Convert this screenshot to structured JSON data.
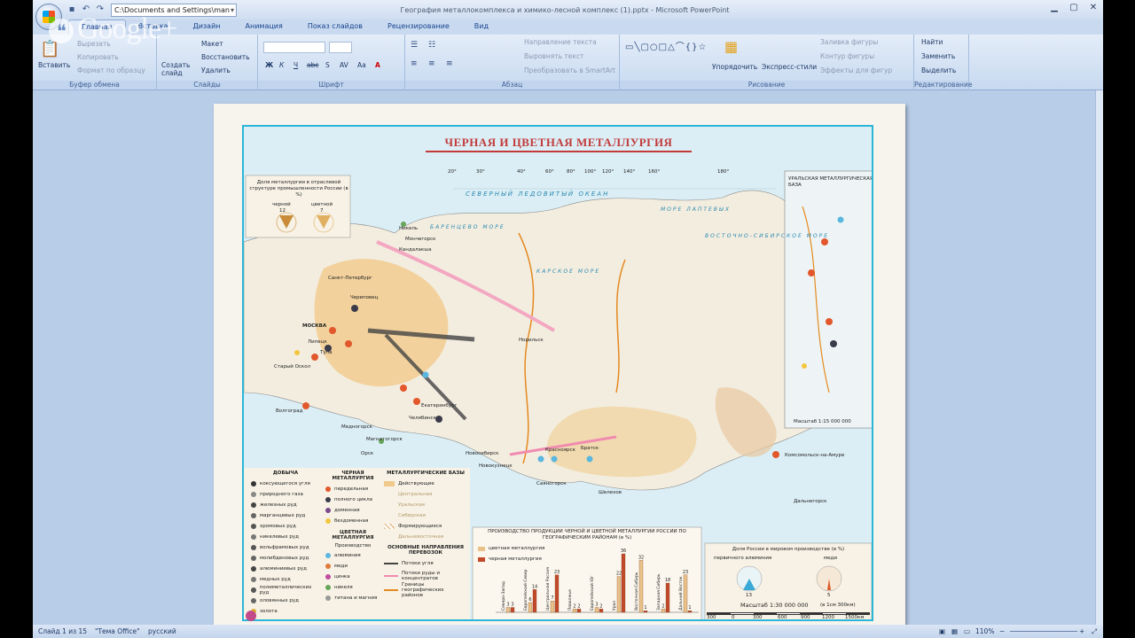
{
  "window": {
    "title": "География металлокомплекса и химико-лесной комплекс (1).pptx - Microsoft PowerPoint",
    "path": "C:\\Documents and Settings\\man"
  },
  "overlay": {
    "google_text": "Google+"
  },
  "tabs": [
    "Главная",
    "Вставка",
    "Дизайн",
    "Анимация",
    "Показ слайдов",
    "Рецензирование",
    "Вид"
  ],
  "ribbon": {
    "clipboard": {
      "label": "Буфер обмена",
      "paste": "Вставить",
      "cut": "Вырезать",
      "copy": "Копировать",
      "format_painter": "Формат по образцу"
    },
    "slides": {
      "label": "Слайды",
      "new_slide": "Создать слайд",
      "layout": "Макет",
      "reset": "Восстановить",
      "delete": "Удалить"
    },
    "font": {
      "label": "Шрифт",
      "bold": "Ж",
      "italic": "К",
      "underline": "Ч",
      "strike": "abc",
      "shadow": "S",
      "spacing": "AV",
      "case": "Aa",
      "color": "A"
    },
    "paragraph": {
      "label": "Абзац",
      "text_direction": "Направление текста",
      "align_text": "Выровнять текст",
      "smartart": "Преобразовать в SmartArt"
    },
    "drawing": {
      "label": "Рисование",
      "arrange": "Упорядочить",
      "quick_styles": "Экспресс-стили",
      "shape_fill": "Заливка фигуры",
      "shape_outline": "Контур фигуры",
      "shape_effects": "Эффекты для фигур"
    },
    "editing": {
      "label": "Редактирование",
      "find": "Найти",
      "replace": "Заменить",
      "select": "Выделить"
    }
  },
  "slide": {
    "map_title": "ЧЕРНАЯ И ЦВЕТНАЯ МЕТАЛЛУРГИЯ",
    "inset_share_title": "Доля металлургии в отраслевой структуре промышленности России (в %)",
    "inset_share": {
      "ferrous_label": "черной",
      "ferrous_value": "12",
      "nonferrous_label": "цветной",
      "nonferrous_value": "7"
    },
    "ural_inset_title": "УРАЛЬСКАЯ МЕТАЛЛУРГИЧЕСКАЯ БАЗА",
    "ural_scale": "Масштаб 1:15 000 000",
    "seas": [
      "СЕВЕРНЫЙ ЛЕДОВИТЫЙ ОКЕАН",
      "БАРЕНЦЕВО МОРЕ",
      "КАРСКОЕ МОРЕ",
      "МОРЕ ЛАПТЕВЫХ",
      "ВОСТОЧНО-СИБИРСКОЕ МОРЕ"
    ],
    "longitudes": [
      "20°",
      "30°",
      "40°",
      "60°",
      "80°",
      "100°",
      "120°",
      "140°",
      "160°",
      "180°"
    ],
    "cities_west": [
      "МОСКВА",
      "Санкт-Петербург",
      "Череповец",
      "Липецк",
      "Старый Оскол",
      "Тула",
      "Волгоград",
      "Мончегорск",
      "Никель",
      "Кандалакша",
      "Норильск",
      "Магнитогорск",
      "Екатеринбург",
      "Челябинск",
      "Медногорск",
      "Орск"
    ],
    "cities_east": [
      "Новокузнецк",
      "Красноярск",
      "Братск",
      "Саяногорск",
      "Шелехов",
      "Комсомольск-на-Амуре",
      "Дальнегорск",
      "Новосибирск"
    ],
    "legend": {
      "mining_header": "ДОБЫЧА",
      "mining": [
        "коксующегося угля",
        "природного газа",
        "железных руд",
        "марганцевых руд",
        "хромовых руд",
        "никелевых руд",
        "вольфрамовых руд",
        "молибденовых руд",
        "алюминиевых руд",
        "медных руд",
        "полиметаллических руд",
        "оловянных руд",
        "золота"
      ],
      "ferrous_header": "ЧЕРНАЯ МЕТАЛЛУРГИЯ",
      "ferrous": [
        "передельная",
        "полного цикла",
        "доменная",
        "бездоменная"
      ],
      "nonferrous_header": "ЦВЕТНАЯ МЕТАЛЛУРГИЯ",
      "nonferrous_sub": "Производство",
      "nonferrous": [
        "алюминия",
        "меди",
        "цинка",
        "никеля",
        "титана и магния"
      ],
      "bases_header": "МЕТАЛЛУРГИЧЕСКИЕ БАЗЫ",
      "bases": [
        "Действующие",
        "Центральная",
        "Уральская",
        "Сибирская",
        "Формирующиеся",
        "Дальневосточная"
      ],
      "flows_header": "ОСНОВНЫЕ НАПРАВЛЕНИЯ ПЕРЕВОЗОК",
      "flows": [
        "Потоки угля",
        "Потоки руды и концентратов",
        "Границы географических районов"
      ]
    },
    "world_share": {
      "title": "Доля России в мировом производстве (в %)",
      "aluminium_label": "первичного алюминия",
      "aluminium_value": "13",
      "copper_label": "меди",
      "copper_value": "5"
    },
    "scale_text": "Масштаб 1:30 000 000",
    "scale_sub": "(в 1см 300км)",
    "scale_ticks": [
      "300",
      "0",
      "300",
      "600",
      "900",
      "1200",
      "1500км"
    ]
  },
  "chart_data": {
    "type": "bar",
    "title": "ПРОИЗВОДСТВО ПРОДУКЦИИ ЧЕРНОЙ И ЦВЕТНОЙ МЕТАЛЛУРГИИ РОССИИ ПО ГЕОГРАФИЧЕСКИМ РАЙОНАМ (в %)",
    "categories": [
      "Северо-Запад",
      "Европейский Север",
      "Центральная Россия",
      "Поволжье",
      "Европейский Юг",
      "Урал",
      "Восточная Сибирь",
      "Западная Сибирь",
      "Дальний Восток"
    ],
    "series": [
      {
        "name": "цветная металлургия",
        "values": [
          3,
          6,
          7,
          2,
          3,
          22,
          32,
          2,
          23
        ]
      },
      {
        "name": "черная металлургия",
        "values": [
          3,
          14,
          23,
          2,
          2,
          36,
          1,
          18,
          1
        ]
      }
    ],
    "ylim": [
      0,
      36
    ]
  },
  "status": {
    "slide_of": "Слайд 1 из 15",
    "theme": "\"Тема Office\"",
    "language": "русский",
    "zoom": "110%"
  }
}
